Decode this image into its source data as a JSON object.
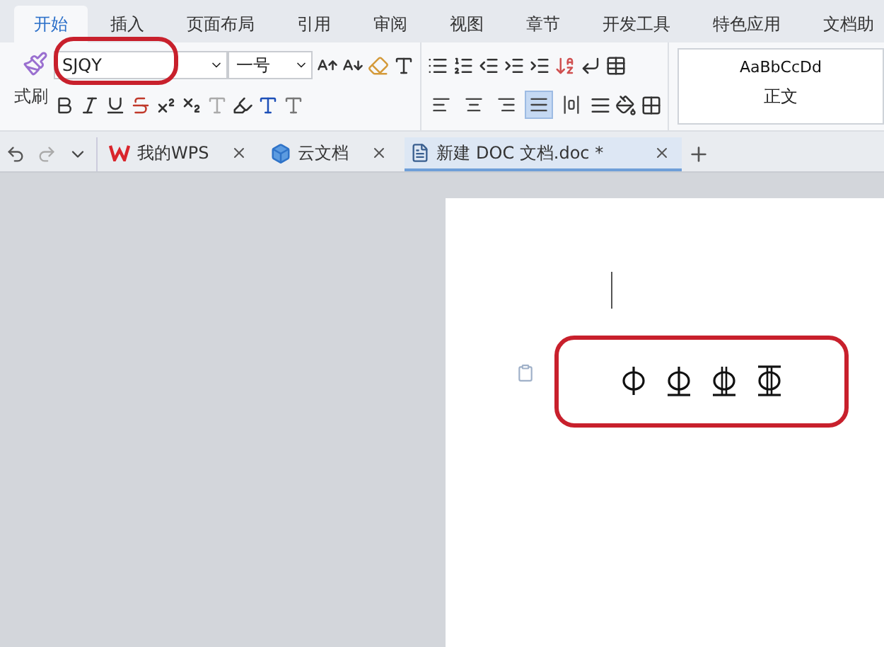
{
  "ribbon_tabs": [
    {
      "label": "开始",
      "selected": true
    },
    {
      "label": "插入",
      "selected": false
    },
    {
      "label": "页面布局",
      "selected": false
    },
    {
      "label": "引用",
      "selected": false
    },
    {
      "label": "审阅",
      "selected": false
    },
    {
      "label": "视图",
      "selected": false
    },
    {
      "label": "章节",
      "selected": false
    },
    {
      "label": "开发工具",
      "selected": false
    },
    {
      "label": "特色应用",
      "selected": false
    },
    {
      "label": "文档助",
      "selected": false
    }
  ],
  "ribbon": {
    "format_painter": "式刷",
    "font": "SJQY",
    "font_size": "一号",
    "style_preview": "AaBbCcDd",
    "style_name": "正文",
    "alignment": [
      {
        "kind": "left",
        "selected": false
      },
      {
        "kind": "center",
        "selected": false
      },
      {
        "kind": "right",
        "selected": false
      },
      {
        "kind": "justify",
        "selected": true
      },
      {
        "kind": "distributed",
        "selected": false
      }
    ]
  },
  "doc_tabs": [
    {
      "label": "我的WPS",
      "kind": "home",
      "selected": false
    },
    {
      "label": "云文档",
      "kind": "cloud",
      "selected": false
    },
    {
      "label": "新建 DOC 文档.doc *",
      "kind": "doc",
      "selected": true
    }
  ],
  "document": {
    "symbols": [
      {
        "kind": "grade-1"
      },
      {
        "kind": "grade-2"
      },
      {
        "kind": "grade-3"
      },
      {
        "kind": "grade-4"
      }
    ]
  }
}
